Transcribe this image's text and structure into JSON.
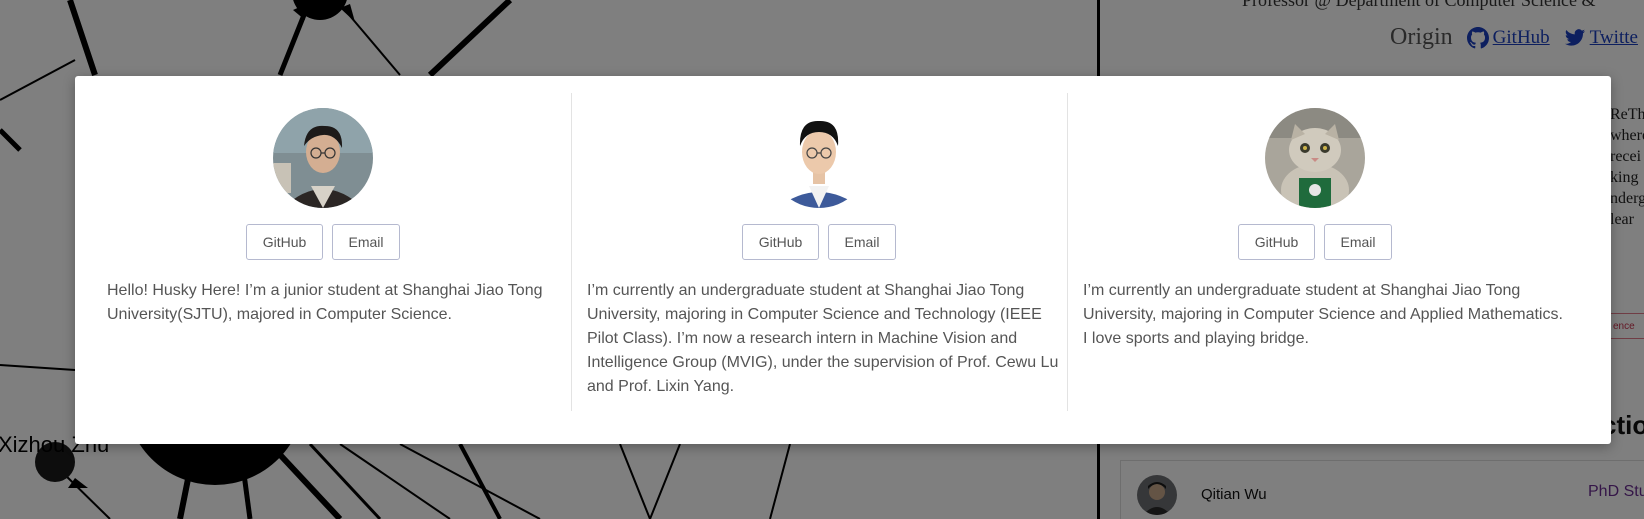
{
  "background": {
    "header_line": "Professor @ Department of Computer Science &",
    "nav": {
      "origin": "Origin",
      "github": "GitHub",
      "twitter": "Twitte"
    },
    "snippet_lines": [
      "ReTh",
      "where",
      "recei",
      "king",
      "nderg",
      "lear"
    ],
    "badge": "ence",
    "section_title": "ctio",
    "node_label": "Xizhou Zhu",
    "member": {
      "name": "Qitian Wu",
      "role": "PhD Stu"
    }
  },
  "modal": {
    "members": [
      {
        "avatar": "person-avatar",
        "github_label": "GitHub",
        "email_label": "Email",
        "bio": "Hello! Husky Here! I’m a junior student at Shanghai Jiao Tong University(SJTU), majored in Computer Science."
      },
      {
        "avatar": "person-avatar",
        "github_label": "GitHub",
        "email_label": "Email",
        "bio": "I’m currently an undergraduate student at Shanghai Jiao Tong University, majoring in Computer Science and Technology (IEEE Pilot Class). I’m now a research intern in Machine Vision and Intelligence Group (MVIG), under the supervision of Prof. Cewu Lu and Prof. Lixin Yang."
      },
      {
        "avatar": "cat-avatar",
        "github_label": "GitHub",
        "email_label": "Email",
        "bio": "I’m currently an undergraduate student at Shanghai Jiao Tong University, majoring in Computer Science and Applied Mathematics. I love sports and playing bridge."
      }
    ]
  },
  "colors": {
    "overlay": "#000000",
    "button_border": "#b5b9cf",
    "text": "#555555",
    "link": "#1a3fbf",
    "role": "#6a2c91"
  }
}
